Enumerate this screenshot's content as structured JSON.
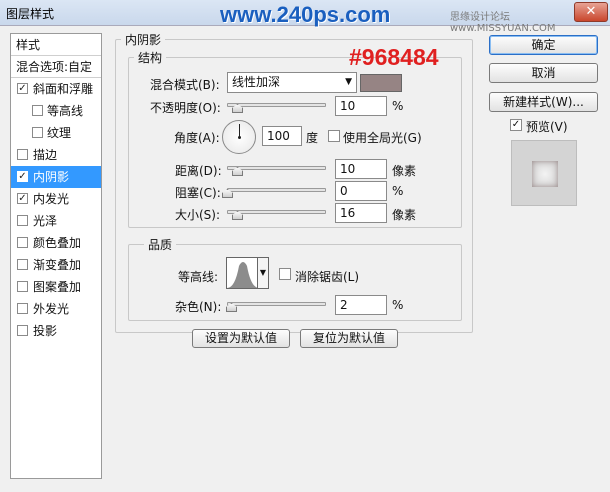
{
  "window": {
    "title": "图层样式",
    "watermark": "www.240ps.com",
    "watermark_sub": "思缘设计论坛 www.MISSYUAN.COM",
    "close_glyph": "✕"
  },
  "styles_panel": {
    "header": "样式",
    "blend_options": "混合选项:自定",
    "items": [
      {
        "label": "斜面和浮雕",
        "checked": true,
        "sub": false
      },
      {
        "label": "等高线",
        "checked": false,
        "sub": true
      },
      {
        "label": "纹理",
        "checked": false,
        "sub": true
      },
      {
        "label": "描边",
        "checked": false,
        "sub": false
      },
      {
        "label": "内阴影",
        "checked": true,
        "sub": false,
        "selected": true
      },
      {
        "label": "内发光",
        "checked": true,
        "sub": false
      },
      {
        "label": "光泽",
        "checked": false,
        "sub": false
      },
      {
        "label": "颜色叠加",
        "checked": false,
        "sub": false
      },
      {
        "label": "渐变叠加",
        "checked": false,
        "sub": false
      },
      {
        "label": "图案叠加",
        "checked": false,
        "sub": false
      },
      {
        "label": "外发光",
        "checked": false,
        "sub": false
      },
      {
        "label": "投影",
        "checked": false,
        "sub": false
      }
    ]
  },
  "inner_shadow": {
    "section_title": "内阴影",
    "structure_title": "结构",
    "hex_annotation": "#968484",
    "color": "#968484",
    "blend_mode_label": "混合模式(B):",
    "blend_mode_value": "线性加深",
    "opacity_label": "不透明度(O):",
    "opacity_value": "10",
    "opacity_unit": "%",
    "angle_label": "角度(A):",
    "angle_value": "100",
    "angle_unit": "度",
    "global_light_label": "使用全局光(G)",
    "distance_label": "距离(D):",
    "distance_value": "10",
    "distance_unit": "像素",
    "choke_label": "阻塞(C):",
    "choke_value": "0",
    "choke_unit": "%",
    "size_label": "大小(S):",
    "size_value": "16",
    "size_unit": "像素",
    "quality_title": "品质",
    "contour_label": "等高线:",
    "antialias_label": "消除锯齿(L)",
    "noise_label": "杂色(N):",
    "noise_value": "2",
    "noise_unit": "%",
    "set_default": "设置为默认值",
    "reset_default": "复位为默认值"
  },
  "actions": {
    "ok": "确定",
    "cancel": "取消",
    "new_style": "新建样式(W)...",
    "preview_label": "预览(V)",
    "preview_checked": true
  }
}
